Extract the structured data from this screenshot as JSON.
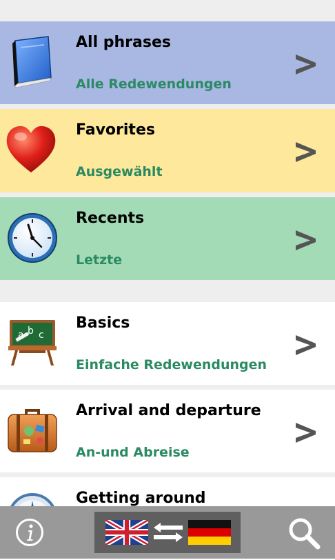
{
  "rows": [
    {
      "title": "All phrases",
      "subtitle": "Alle Redewendungen",
      "icon": "book-icon",
      "bg": "#a9b8e3"
    },
    {
      "title": "Favorites",
      "subtitle": "Ausgewählt",
      "icon": "heart-icon",
      "bg": "#fde89b"
    },
    {
      "title": "Recents",
      "subtitle": "Letzte",
      "icon": "clock-icon",
      "bg": "#a3dbb6"
    },
    {
      "title": "Basics",
      "subtitle": "Einfache Redewendungen",
      "icon": "chalkboard-icon",
      "bg": "#ffffff"
    },
    {
      "title": "Arrival and departure",
      "subtitle": "An-und Abreise",
      "icon": "suitcase-icon",
      "bg": "#ffffff"
    },
    {
      "title": "Getting around",
      "subtitle": "",
      "icon": "compass-icon",
      "bg": "#ffffff"
    }
  ],
  "chevron_glyph": "chevron-right-icon",
  "bottom_bar": {
    "info_icon": "info-icon",
    "language_pair": {
      "from_flag": "uk-flag-icon",
      "to_flag": "germany-flag-icon",
      "swap_icon": "swap-arrows-icon"
    },
    "search_icon": "search-icon"
  },
  "colors": {
    "subtitle": "#2a8a63",
    "chevron": "#555555",
    "bar": "#999999"
  }
}
